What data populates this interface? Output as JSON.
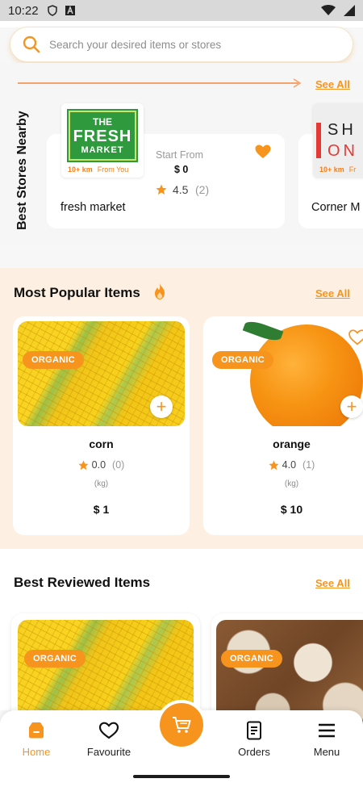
{
  "status_bar": {
    "time": "10:22"
  },
  "search": {
    "placeholder": "Search your desired items or stores"
  },
  "stores": {
    "title": "Best Stores Nearby",
    "see_all": "See All",
    "items": [
      {
        "name": "fresh market",
        "logo_line1": "THE",
        "logo_line2": "FRESH",
        "logo_line3": "MARKET",
        "distance": "10+ km",
        "from_you": "From You",
        "start_from_label": "Start From",
        "start_price": "$ 0",
        "rating": "4.5",
        "rating_count": "(2)"
      },
      {
        "name": "Corner M",
        "logo_text_top": "SH",
        "logo_text_bottom": "ON",
        "distance": "10+ km",
        "from_you": "Fr"
      }
    ]
  },
  "popular": {
    "title": "Most Popular Items",
    "see_all": "See All",
    "items": [
      {
        "badge": "ORGANIC",
        "name": "corn",
        "rating": "0.0",
        "rating_count": "(0)",
        "unit": "(kg)",
        "price": "$ 1"
      },
      {
        "badge": "ORGANIC",
        "name": "orange",
        "rating": "4.0",
        "rating_count": "(1)",
        "unit": "(kg)",
        "price": "$ 10"
      }
    ]
  },
  "best_reviewed": {
    "title": "Best Reviewed Items",
    "see_all": "See All",
    "items": [
      {
        "badge": "ORGANIC"
      },
      {
        "badge": "ORGANIC"
      }
    ]
  },
  "nav": {
    "home": "Home",
    "favourite": "Favourite",
    "orders": "Orders",
    "menu": "Menu"
  },
  "colors": {
    "accent": "#f7941d",
    "popular_bg": "#fdf0e2"
  }
}
